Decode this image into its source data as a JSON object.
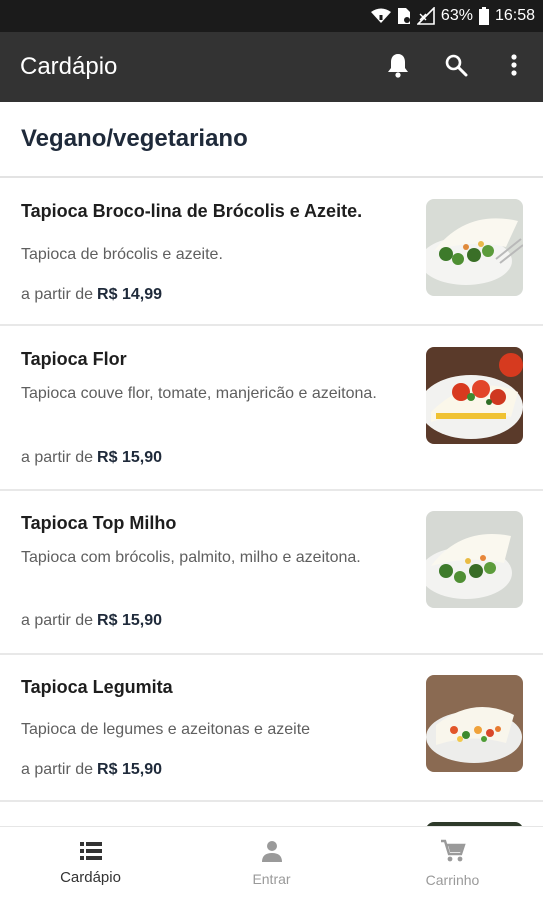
{
  "status_bar": {
    "battery_percent": "63%",
    "time": "16:58"
  },
  "app_bar": {
    "title": "Cardápio",
    "actions": [
      "bell-icon",
      "search-icon",
      "more-vert-icon"
    ]
  },
  "section": {
    "title": "Vegano/vegetariano"
  },
  "items": [
    {
      "name": "Tapioca Broco-lina de Brócolis e Azeite.",
      "description": "Tapioca de brócolis e azeite.",
      "price_prefix": "a partir de",
      "price": "R$ 14,99"
    },
    {
      "name": "Tapioca Flor",
      "description": "Tapioca couve flor, tomate, manjericão e azeitona.",
      "price_prefix": "a partir de",
      "price": "R$ 15,90"
    },
    {
      "name": "Tapioca Top Milho",
      "description": "Tapioca com brócolis, palmito, milho e azeitona.",
      "price_prefix": "a partir de",
      "price": "R$ 15,90"
    },
    {
      "name": "Tapioca Legumita",
      "description": "Tapioca de legumes e azeitonas e azeite",
      "price_prefix": "a partir de",
      "price": "R$ 15,90"
    }
  ],
  "bottom_nav": [
    {
      "label": "Cardápio",
      "icon": "menu-list-icon",
      "active": true
    },
    {
      "label": "Entrar",
      "icon": "person-icon",
      "active": false
    },
    {
      "label": "Carrinho",
      "icon": "cart-icon",
      "active": false
    }
  ],
  "colors": {
    "app_bar": "#333333",
    "status_bar": "#1b1b1b",
    "price": "#1f2a3a"
  }
}
